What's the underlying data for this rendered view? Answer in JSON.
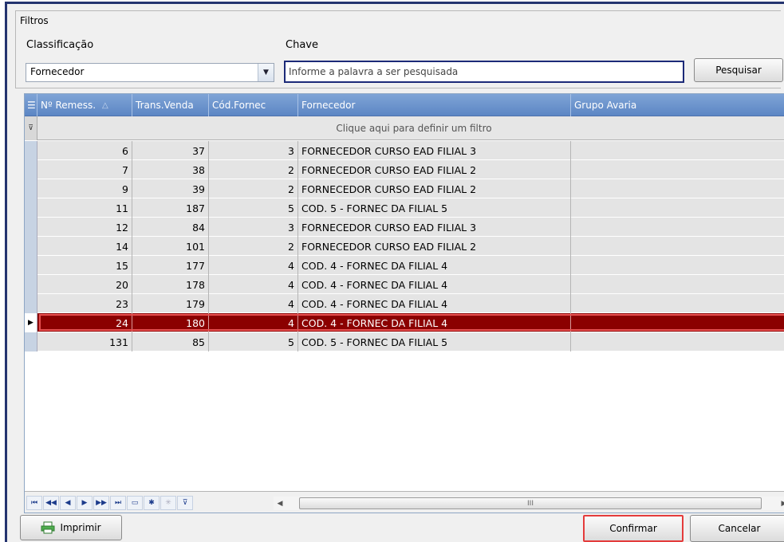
{
  "filters": {
    "group_title": "Filtros",
    "classification_label": "Classificação",
    "classification_value": "Fornecedor",
    "key_label": "Chave",
    "key_placeholder": "Informe a palavra a ser pesquisada",
    "search_button": "Pesquisar"
  },
  "grid": {
    "columns": [
      "Nº Remess.",
      "Trans.Venda",
      "Cód.Fornec",
      "Fornecedor",
      "Grupo Avaria"
    ],
    "filter_hint": "Clique aqui para definir um filtro",
    "rows": [
      [
        "6",
        "37",
        "3",
        "FORNECEDOR CURSO EAD FILIAL 3",
        ""
      ],
      [
        "7",
        "38",
        "2",
        "FORNECEDOR CURSO EAD FILIAL 2",
        ""
      ],
      [
        "9",
        "39",
        "2",
        "FORNECEDOR CURSO EAD FILIAL 2",
        ""
      ],
      [
        "11",
        "187",
        "5",
        "COD. 5 - FORNEC DA FILIAL 5",
        ""
      ],
      [
        "12",
        "84",
        "3",
        "FORNECEDOR CURSO EAD FILIAL 3",
        ""
      ],
      [
        "14",
        "101",
        "2",
        "FORNECEDOR CURSO EAD FILIAL 2",
        ""
      ],
      [
        "15",
        "177",
        "4",
        "COD. 4 - FORNEC DA FILIAL 4",
        ""
      ],
      [
        "20",
        "178",
        "4",
        "COD. 4 - FORNEC DA FILIAL 4",
        ""
      ],
      [
        "23",
        "179",
        "4",
        "COD. 4 - FORNEC DA FILIAL 4",
        ""
      ],
      [
        "24",
        "180",
        "4",
        "COD. 4 - FORNEC DA FILIAL 4",
        ""
      ],
      [
        "131",
        "85",
        "5",
        "COD. 5 - FORNEC DA FILIAL 5",
        ""
      ]
    ],
    "selected_row": 9,
    "scroll_thumb_glyph": "III"
  },
  "footer": {
    "print_button": "Imprimir",
    "confirm_button": "Confirmar",
    "cancel_button": "Cancelar"
  },
  "colors": {
    "selected_row": "#8b0000",
    "header": "#6b93cc",
    "highlight_border": "#e43b3b"
  }
}
